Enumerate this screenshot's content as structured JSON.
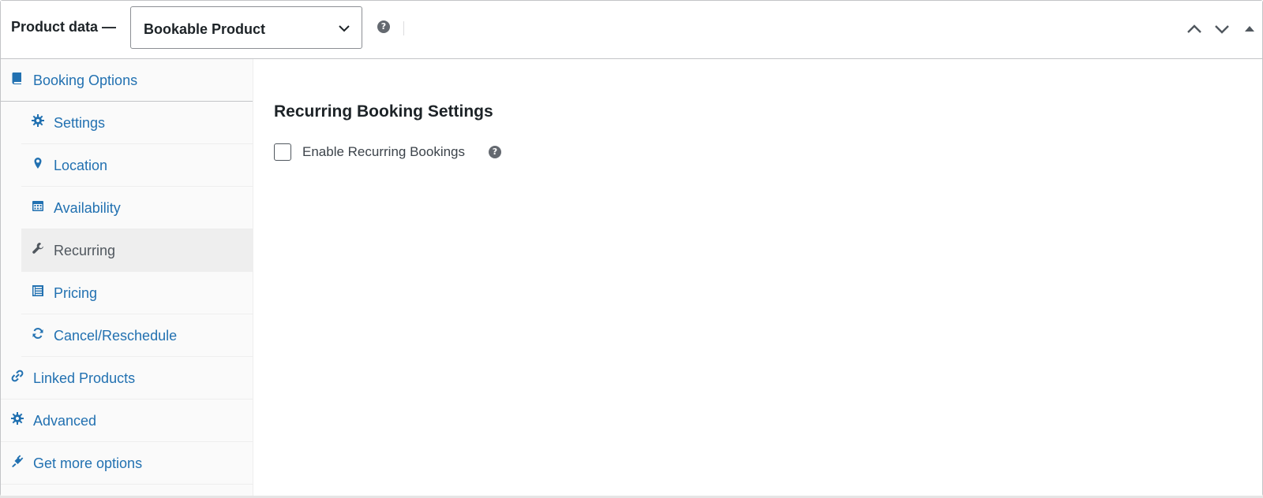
{
  "header": {
    "title": "Product data —",
    "product_type": "Bookable Product",
    "help_icon": "question-circle-icon",
    "buttons": [
      "chevron-up-icon",
      "chevron-down-icon",
      "triangle-up-icon"
    ]
  },
  "sidebar": {
    "items": [
      {
        "label": "Booking Options",
        "icon": "book-icon"
      },
      {
        "label": "Settings",
        "icon": "gear-icon"
      },
      {
        "label": "Location",
        "icon": "location-pin-icon"
      },
      {
        "label": "Availability",
        "icon": "calendar-icon"
      },
      {
        "label": "Recurring",
        "icon": "wrench-icon",
        "active": true
      },
      {
        "label": "Pricing",
        "icon": "list-table-icon"
      },
      {
        "label": "Cancel/Reschedule",
        "icon": "refresh-icon"
      },
      {
        "label": "Linked Products",
        "icon": "link-icon"
      },
      {
        "label": "Advanced",
        "icon": "gear-icon"
      },
      {
        "label": "Get more options",
        "icon": "plugin-icon"
      }
    ]
  },
  "main": {
    "section_title": "Recurring Booking Settings",
    "enable_recurring": {
      "label": "Enable Recurring Bookings",
      "checked": false
    }
  },
  "colors": {
    "link": "#2271b1",
    "text": "#1d2327",
    "active_bg": "#eeeeee",
    "sidebar_bg": "#fafafa",
    "border": "#c3c4c7"
  }
}
